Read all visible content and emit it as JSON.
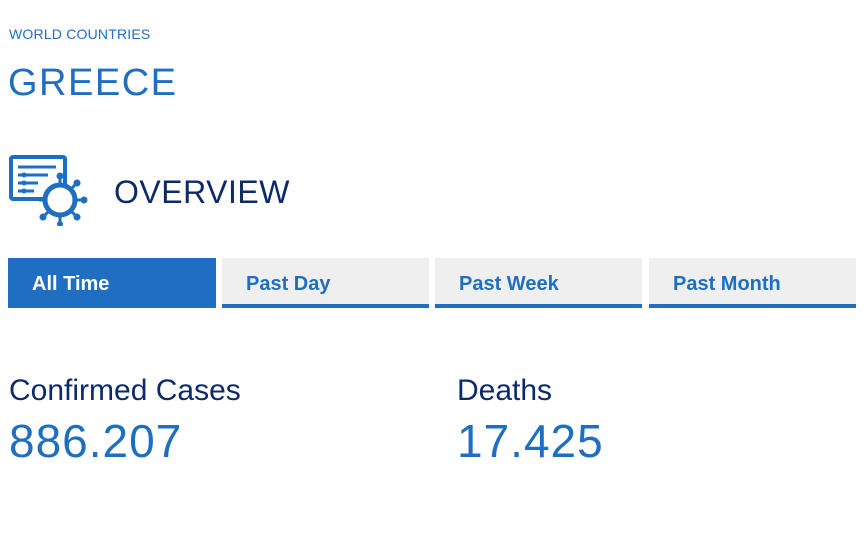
{
  "breadcrumb": "WORLD COUNTRIES",
  "country": "GREECE",
  "section": {
    "title": "OVERVIEW",
    "icon": "report-virus-icon"
  },
  "tabs": [
    {
      "label": "All Time",
      "active": true
    },
    {
      "label": "Past Day",
      "active": false
    },
    {
      "label": "Past Week",
      "active": false
    },
    {
      "label": "Past Month",
      "active": false
    }
  ],
  "stats": [
    {
      "label": "Confirmed Cases",
      "value": "886.207"
    },
    {
      "label": "Deaths",
      "value": "17.425"
    }
  ],
  "colors": {
    "accent": "#1e6fc2",
    "heading": "#0b2a6b",
    "tab_inactive_bg": "#efefef"
  }
}
